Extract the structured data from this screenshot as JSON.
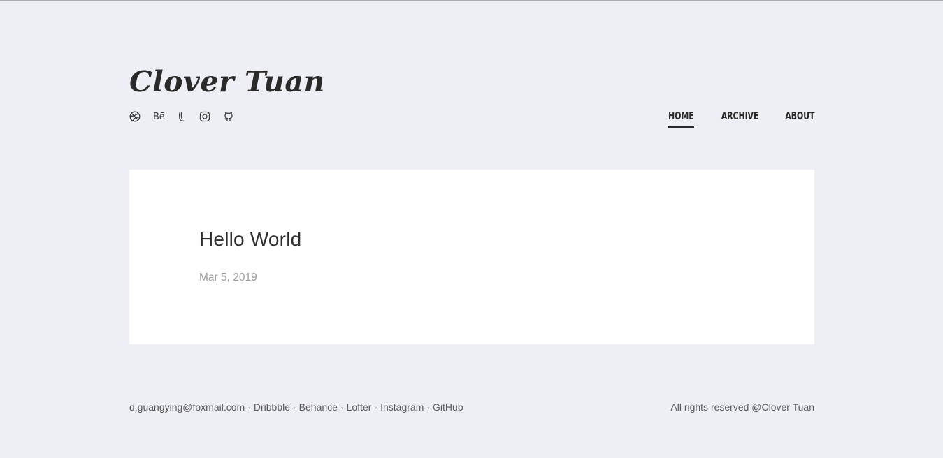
{
  "site": {
    "title": "Clover Tuan"
  },
  "socials": [
    {
      "name": "dribbble",
      "icon": "dribbble-icon"
    },
    {
      "name": "behance",
      "icon": "behance-icon",
      "glyph": "Bē"
    },
    {
      "name": "lofter",
      "icon": "lofter-icon"
    },
    {
      "name": "instagram",
      "icon": "instagram-icon"
    },
    {
      "name": "github",
      "icon": "github-icon"
    }
  ],
  "nav": {
    "home": "HOME",
    "archive": "ARCHIVE",
    "about": "ABOUT",
    "active": "home"
  },
  "post": {
    "title": "Hello World",
    "date": "Mar 5, 2019"
  },
  "footer": {
    "email": "d.guangying@foxmail.com",
    "separator": "·",
    "links": [
      "Dribbble",
      "Behance",
      "Lofter",
      "Instagram",
      "GitHub"
    ],
    "copyright": "All rights reserved @Clover Tuan"
  },
  "colors": {
    "background": "#eeeff4",
    "card": "#ffffff",
    "text": "#2a2a2a",
    "muted": "#9a9a9a"
  }
}
